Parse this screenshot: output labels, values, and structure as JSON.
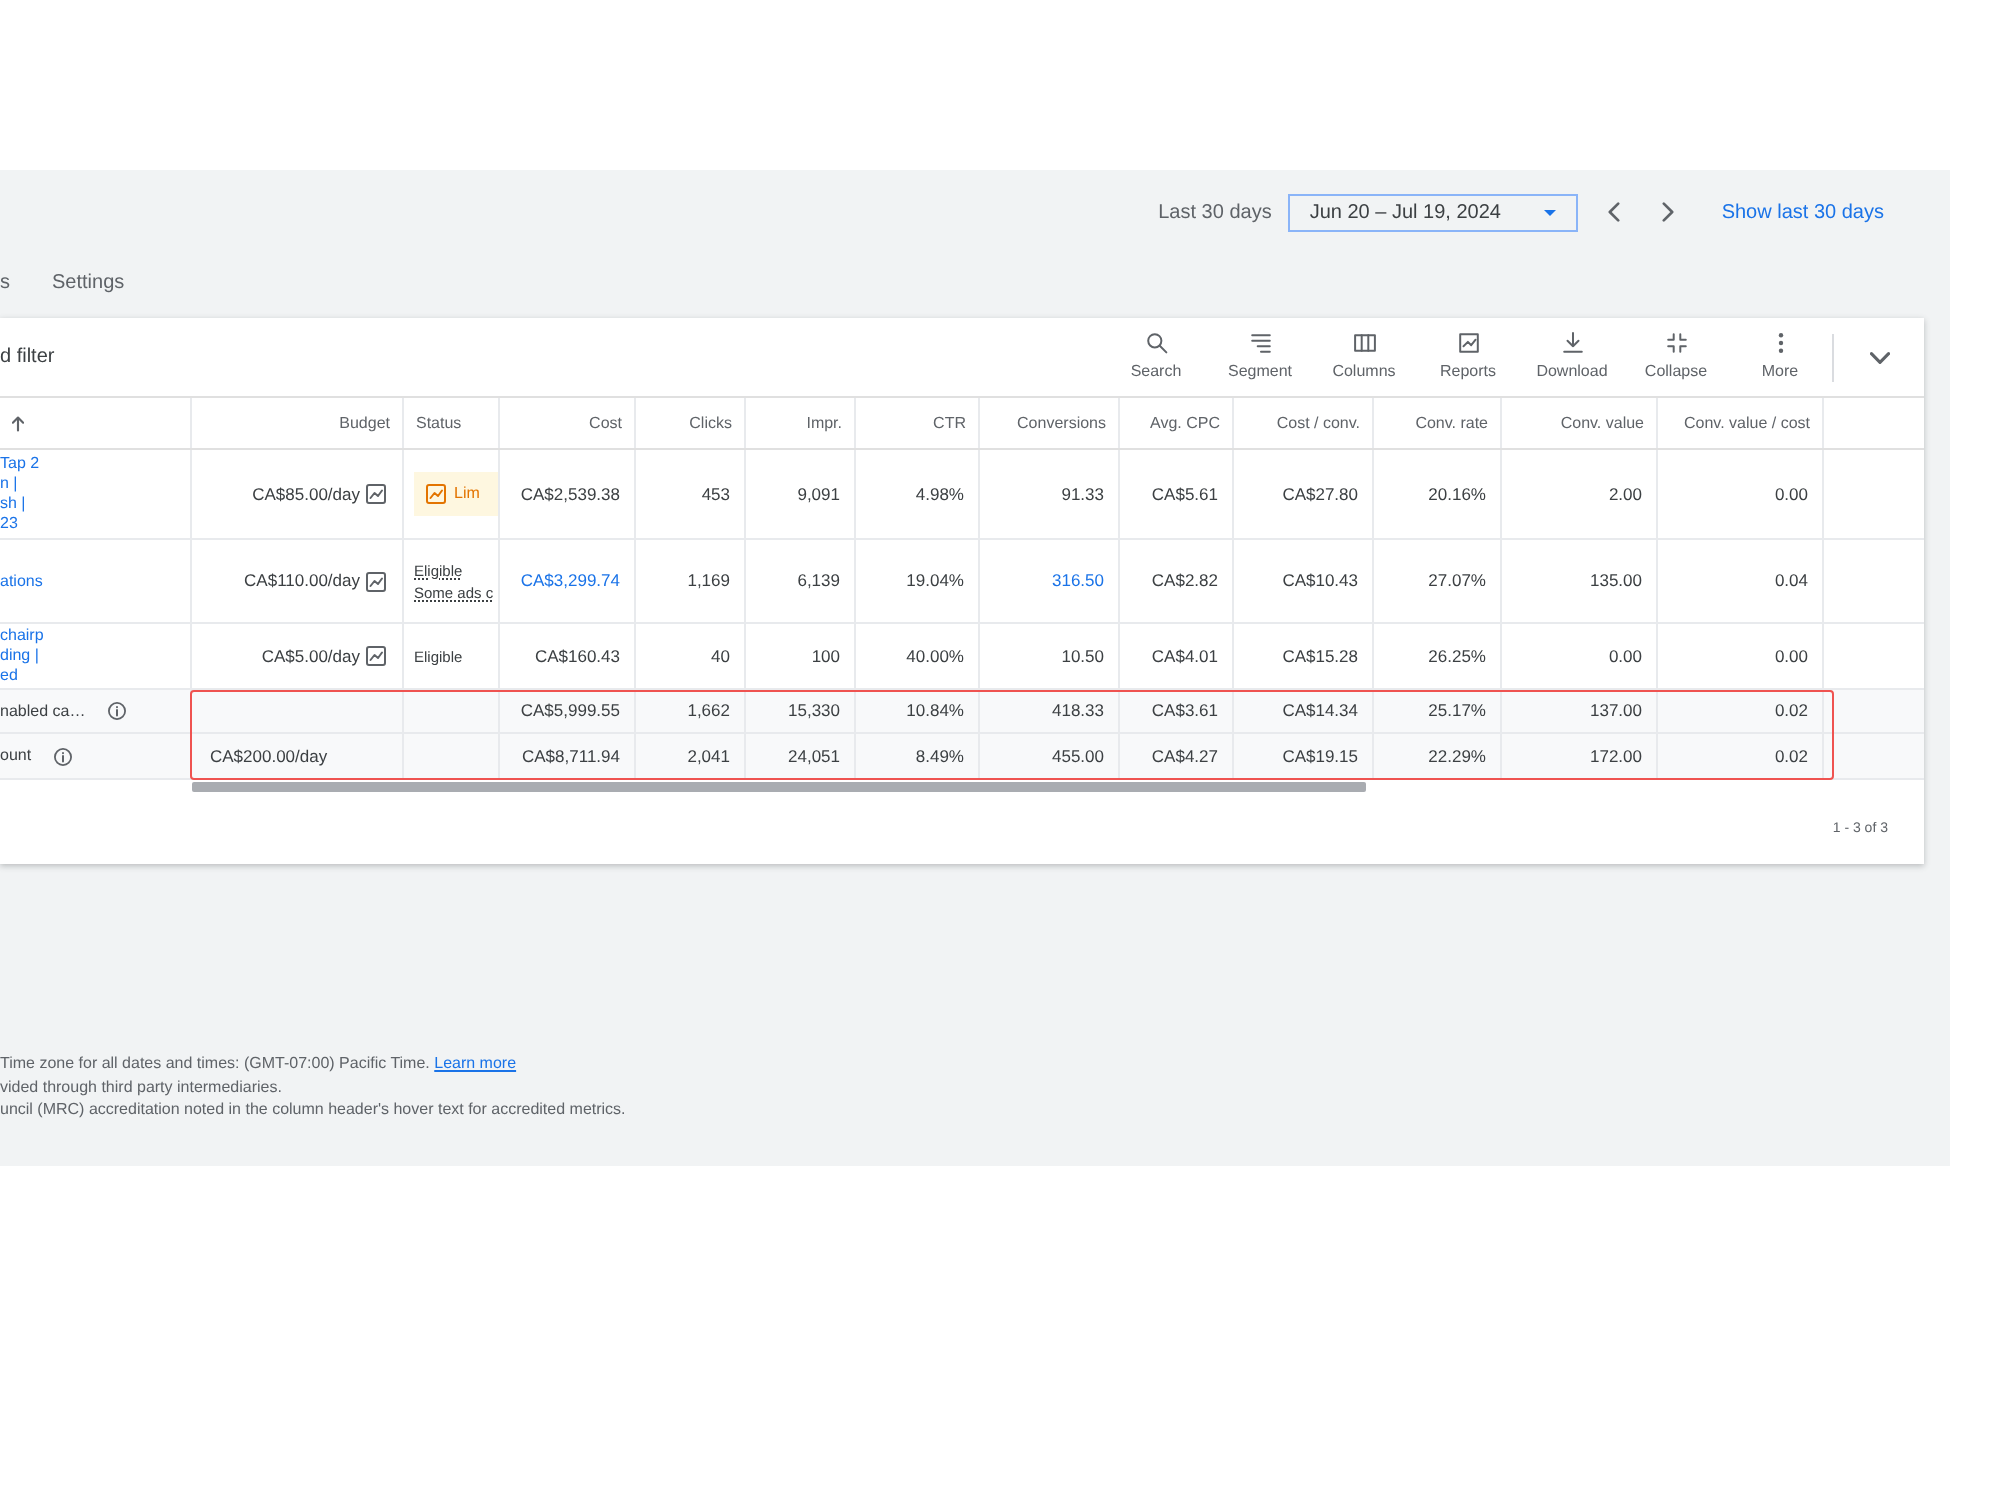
{
  "date_bar": {
    "label": "Last 30 days",
    "range": "Jun 20 – Jul 19, 2024",
    "shortcut": "Show last 30 days"
  },
  "tabs": [
    "s",
    "Settings"
  ],
  "toolbar": {
    "filter": "d filter",
    "tools": [
      "Search",
      "Segment",
      "Columns",
      "Reports",
      "Download",
      "Collapse",
      "More"
    ]
  },
  "table": {
    "columns": [
      {
        "label": "Budget",
        "kind": "number"
      },
      {
        "label": "Status",
        "kind": "text"
      },
      {
        "label": "Cost",
        "kind": "number"
      },
      {
        "label": "Clicks",
        "kind": "number"
      },
      {
        "label": "Impr.",
        "kind": "number"
      },
      {
        "label": "CTR",
        "kind": "number"
      },
      {
        "label": "Conversions",
        "kind": "number"
      },
      {
        "label": "Avg. CPC",
        "kind": "number"
      },
      {
        "label": "Cost / conv.",
        "kind": "number"
      },
      {
        "label": "Conv. rate",
        "kind": "number"
      },
      {
        "label": "Conv. value",
        "kind": "number"
      },
      {
        "label": "Conv. value / cost",
        "kind": "number"
      }
    ],
    "rows": [
      {
        "name_lines": [
          "Tap 2",
          "n |",
          "sh |",
          "23"
        ],
        "budget": "CA$85.00/day",
        "status": {
          "kind": "badge",
          "lines": [
            "Lim"
          ]
        },
        "metrics": [
          {
            "text": "CA$2,539.38",
            "link": false
          },
          {
            "text": "453",
            "link": false
          },
          {
            "text": "9,091",
            "link": false
          },
          {
            "text": "4.98%",
            "link": false
          },
          {
            "text": "91.33",
            "link": false
          },
          {
            "text": "CA$5.61",
            "link": false
          },
          {
            "text": "CA$27.80",
            "link": false
          },
          {
            "text": "20.16%",
            "link": false
          },
          {
            "text": "2.00",
            "link": false
          },
          {
            "text": "0.00",
            "link": false
          }
        ]
      },
      {
        "name_lines": [
          "ations"
        ],
        "budget": "CA$110.00/day",
        "status": {
          "kind": "note",
          "lines": [
            "Eligible",
            "Some ads c"
          ]
        },
        "metrics": [
          {
            "text": "CA$3,299.74",
            "link": true
          },
          {
            "text": "1,169",
            "link": false
          },
          {
            "text": "6,139",
            "link": false
          },
          {
            "text": "19.04%",
            "link": false
          },
          {
            "text": "316.50",
            "link": true
          },
          {
            "text": "CA$2.82",
            "link": false
          },
          {
            "text": "CA$10.43",
            "link": false
          },
          {
            "text": "27.07%",
            "link": false
          },
          {
            "text": "135.00",
            "link": false
          },
          {
            "text": "0.04",
            "link": false
          }
        ]
      },
      {
        "name_lines": [
          "chairp",
          "ding |",
          "ed"
        ],
        "budget": "CA$5.00/day",
        "status": {
          "kind": "plain",
          "lines": [
            "Eligible"
          ]
        },
        "metrics": [
          {
            "text": "CA$160.43",
            "link": false
          },
          {
            "text": "40",
            "link": false
          },
          {
            "text": "100",
            "link": false
          },
          {
            "text": "40.00%",
            "link": false
          },
          {
            "text": "10.50",
            "link": false
          },
          {
            "text": "CA$4.01",
            "link": false
          },
          {
            "text": "CA$15.28",
            "link": false
          },
          {
            "text": "26.25%",
            "link": false
          },
          {
            "text": "0.00",
            "link": false
          },
          {
            "text": "0.00",
            "link": false
          }
        ]
      }
    ],
    "totals": {
      "highlighted": true,
      "rows": [
        {
          "label": "nabled ca…",
          "metrics": [
            {
              "text": "CA$5,999.55",
              "link": false
            },
            {
              "text": "1,662",
              "link": false
            },
            {
              "text": "15,330",
              "link": false
            },
            {
              "text": "10.84%",
              "link": false
            },
            {
              "text": "418.33",
              "link": false
            },
            {
              "text": "CA$3.61",
              "link": false
            },
            {
              "text": "CA$14.34",
              "link": false
            },
            {
              "text": "25.17%",
              "link": false
            },
            {
              "text": "137.00",
              "link": false
            },
            {
              "text": "0.02",
              "link": false
            }
          ]
        },
        {
          "label": "ount",
          "budget": "CA$200.00/day",
          "metrics": [
            {
              "text": "CA$8,711.94",
              "link": false
            },
            {
              "text": "2,041",
              "link": false
            },
            {
              "text": "24,051",
              "link": false
            },
            {
              "text": "8.49%",
              "link": false
            },
            {
              "text": "455.00",
              "link": false
            },
            {
              "text": "CA$4.27",
              "link": false
            },
            {
              "text": "CA$19.15",
              "link": false
            },
            {
              "text": "22.29%",
              "link": false
            },
            {
              "text": "172.00",
              "link": false
            },
            {
              "text": "0.02",
              "link": false
            }
          ]
        }
      ]
    },
    "pagination": "1 - 3 of 3"
  },
  "footer": [
    {
      "text": "Time zone for all dates and times: (GMT-07:00) Pacific Time.",
      "link": "Learn more"
    },
    {
      "text": "vided through third party intermediaries."
    },
    {
      "text": "uncil (MRC) accreditation noted in the column header's hover text for accredited metrics."
    }
  ]
}
